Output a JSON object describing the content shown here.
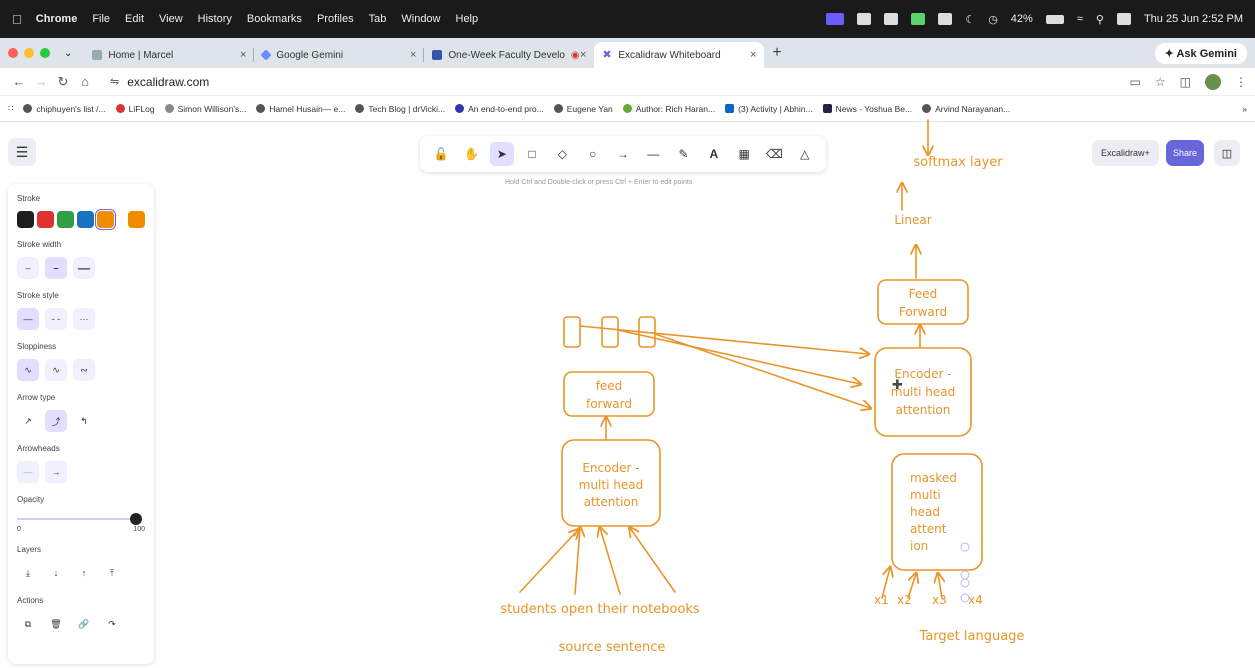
{
  "menubar": {
    "items": [
      "Chrome",
      "File",
      "Edit",
      "View",
      "History",
      "Bookmarks",
      "Profiles",
      "Tab",
      "Window",
      "Help"
    ],
    "battery": "42%",
    "datetime": "Thu 25 Jun  2:52 PM"
  },
  "tabs": [
    {
      "title": "Home | Marcel",
      "active": false
    },
    {
      "title": "Google Gemini",
      "active": false
    },
    {
      "title": "One-Week Faculty Develo",
      "active": false
    },
    {
      "title": "Excalidraw Whiteboard",
      "active": true
    }
  ],
  "ask_gemini": "Ask Gemini",
  "address": {
    "url": "excalidraw.com"
  },
  "bookmarks": [
    "chiphuyen's list /...",
    "LiFLog",
    "Simon Willison's...",
    "Hamel Husain— e...",
    "Tech Blog | drVicki...",
    "An end-to-end pro...",
    "Eugene Yan",
    "Author: Rich Haran...",
    "(3) Activity | Abhin...",
    "News - Yoshua Be...",
    "Arvind Narayanan..."
  ],
  "bookmarks_more": "»",
  "toolbar": {
    "tools": [
      "lock",
      "hand",
      "selection",
      "rectangle",
      "diamond",
      "ellipse",
      "arrow",
      "line",
      "draw",
      "text",
      "image",
      "eraser",
      "more"
    ],
    "hint": "Hold Ctrl and Double-click or press Ctrl + Enter to edit points"
  },
  "header": {
    "library_label": "Excalidraw+",
    "share_label": "Share"
  },
  "properties": {
    "stroke_label": "Stroke",
    "stroke_colors": [
      "#1e1e1e",
      "#e03131",
      "#2f9e44",
      "#1971c2",
      "#f08c00"
    ],
    "current_color": "#f08c00",
    "stroke_width_label": "Stroke width",
    "stroke_style_label": "Stroke style",
    "sloppiness_label": "Sloppiness",
    "arrow_type_label": "Arrow type",
    "arrowheads_label": "Arrowheads",
    "opacity_label": "Opacity",
    "opacity_min": "0",
    "opacity_max": "100",
    "opacity_value": 100,
    "layers_label": "Layers",
    "actions_label": "Actions"
  },
  "diagram": {
    "accent": "#e8952a",
    "left_feed": [
      "feed",
      "forward"
    ],
    "left_encoder": [
      "Encoder -",
      "multi head",
      "attention"
    ],
    "source_words": "students open  their notebooks",
    "source_label": "source sentence",
    "right_feed": [
      "Feed",
      "Forward"
    ],
    "right_encoder": [
      "Encoder -",
      "multi head",
      "attention"
    ],
    "masked": [
      "masked",
      "multi",
      "head",
      "attent",
      "ion"
    ],
    "linear": "Linear",
    "softmax": "softmax layer",
    "inputs": [
      "x1",
      "x2",
      "x3",
      "x4"
    ],
    "target_label": "Target language"
  }
}
